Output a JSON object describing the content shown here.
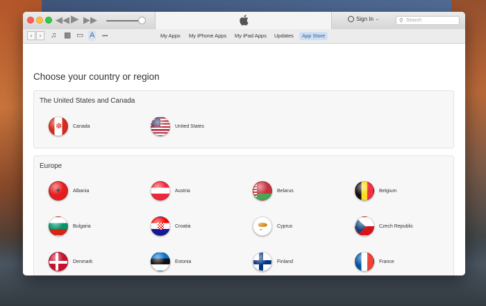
{
  "toolbar": {
    "tabs": [
      {
        "label": "My Apps"
      },
      {
        "label": "My iPhone Apps"
      },
      {
        "label": "My iPad Apps"
      },
      {
        "label": "Updates"
      },
      {
        "label": "App Store"
      }
    ],
    "active_tab": "App Store",
    "more_label": "•••"
  },
  "titlebar": {
    "signin_label": "Sign In",
    "search_placeholder": "Search"
  },
  "page": {
    "title": "Choose your country or region"
  },
  "sections": [
    {
      "title": "The United States and Canada",
      "countries": [
        {
          "name": "Canada",
          "flag": "flag-canada-icon"
        },
        {
          "name": "United States",
          "flag": "flag-united-states-icon"
        }
      ]
    },
    {
      "title": "Europe",
      "countries": [
        {
          "name": "Albania",
          "flag": "flag-albania-icon"
        },
        {
          "name": "Austria",
          "flag": "flag-austria-icon"
        },
        {
          "name": "Belarus",
          "flag": "flag-belarus-icon"
        },
        {
          "name": "Belgium",
          "flag": "flag-belgium-icon"
        },
        {
          "name": "Bulgaria",
          "flag": "flag-bulgaria-icon"
        },
        {
          "name": "Croatia",
          "flag": "flag-croatia-icon"
        },
        {
          "name": "Cyprus",
          "flag": "flag-cyprus-icon"
        },
        {
          "name": "Czech Republic",
          "flag": "flag-czech-republic-icon"
        },
        {
          "name": "Denmark",
          "flag": "flag-denmark-icon"
        },
        {
          "name": "Estonia",
          "flag": "flag-estonia-icon"
        },
        {
          "name": "Finland",
          "flag": "flag-finland-icon"
        },
        {
          "name": "France",
          "flag": "flag-france-icon"
        }
      ]
    }
  ],
  "colors": {
    "active_tab_bg": "#cfdff3",
    "close": "#fc605c",
    "minimize": "#fdbc40",
    "zoom": "#34c84a"
  }
}
